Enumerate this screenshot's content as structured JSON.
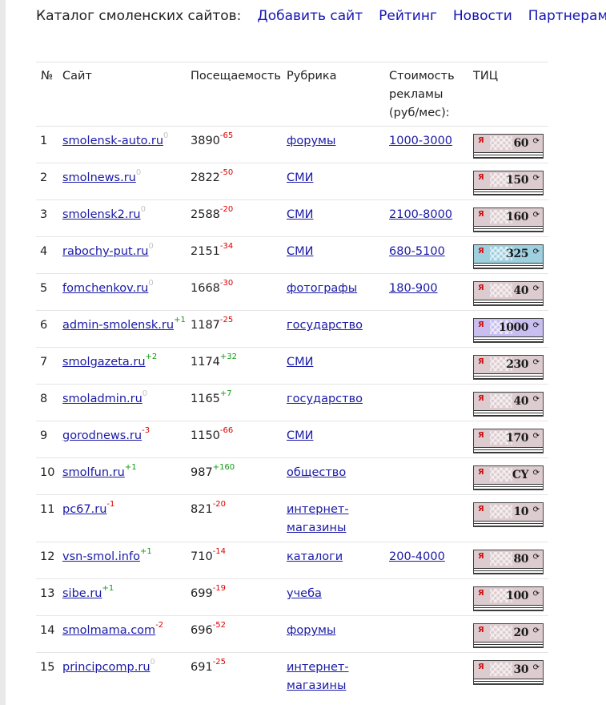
{
  "nav": {
    "title": "Каталог смоленских сайтов:",
    "links": [
      "Добавить сайт",
      "Рейтинг",
      "Новости",
      "Партнерам"
    ]
  },
  "table": {
    "headers": {
      "num": "№",
      "site": "Сайт",
      "visits": "Посещаемость",
      "category": "Рубрика",
      "price": "Стоимость рекламы (руб/мес):",
      "tic": "ТИЦ"
    },
    "rows": [
      {
        "num": "1",
        "site": "smolensk-auto.ru",
        "site_delta": "0",
        "visits": "3890",
        "visits_delta": "-65",
        "category": "форумы",
        "price": "1000-3000",
        "tic": "60"
      },
      {
        "num": "2",
        "site": "smolnews.ru",
        "site_delta": "0",
        "visits": "2822",
        "visits_delta": "-50",
        "category": "СМИ",
        "price": "",
        "tic": "150"
      },
      {
        "num": "3",
        "site": "smolensk2.ru",
        "site_delta": "0",
        "visits": "2588",
        "visits_delta": "-20",
        "category": "СМИ",
        "price": "2100-8000",
        "tic": "160"
      },
      {
        "num": "4",
        "site": "rabochy-put.ru",
        "site_delta": "0",
        "visits": "2151",
        "visits_delta": "-34",
        "category": "СМИ",
        "price": "680-5100",
        "tic": "325"
      },
      {
        "num": "5",
        "site": "fomchenkov.ru",
        "site_delta": "0",
        "visits": "1668",
        "visits_delta": "-30",
        "category": "фотографы",
        "price": "180-900",
        "tic": "40"
      },
      {
        "num": "6",
        "site": "admin-smolensk.ru",
        "site_delta": "+1",
        "visits": "1187",
        "visits_delta": "-25",
        "category": "государство",
        "price": "",
        "tic": "1000"
      },
      {
        "num": "7",
        "site": "smolgazeta.ru",
        "site_delta": "+2",
        "visits": "1174",
        "visits_delta": "+32",
        "category": "СМИ",
        "price": "",
        "tic": "230"
      },
      {
        "num": "8",
        "site": "smoladmin.ru",
        "site_delta": "0",
        "visits": "1165",
        "visits_delta": "+7",
        "category": "государство",
        "price": "",
        "tic": "40"
      },
      {
        "num": "9",
        "site": "gorodnews.ru",
        "site_delta": "-3",
        "visits": "1150",
        "visits_delta": "-66",
        "category": "СМИ",
        "price": "",
        "tic": "170"
      },
      {
        "num": "10",
        "site": "smolfun.ru",
        "site_delta": "+1",
        "visits": "987",
        "visits_delta": "+160",
        "category": "общество",
        "price": "",
        "tic": "CY"
      },
      {
        "num": "11",
        "site": "pc67.ru",
        "site_delta": "-1",
        "visits": "821",
        "visits_delta": "-20",
        "category": "интернет-магазины",
        "price": "",
        "tic": "10"
      },
      {
        "num": "12",
        "site": "vsn-smol.info",
        "site_delta": "+1",
        "visits": "710",
        "visits_delta": "-14",
        "category": "каталоги",
        "price": "200-4000",
        "tic": "80"
      },
      {
        "num": "13",
        "site": "sibe.ru",
        "site_delta": "+1",
        "visits": "699",
        "visits_delta": "-19",
        "category": "учеба",
        "price": "",
        "tic": "100"
      },
      {
        "num": "14",
        "site": "smolmama.com",
        "site_delta": "-2",
        "visits": "696",
        "visits_delta": "-52",
        "category": "форумы",
        "price": "",
        "tic": "20"
      },
      {
        "num": "15",
        "site": "principcomp.ru",
        "site_delta": "0",
        "visits": "691",
        "visits_delta": "-25",
        "category": "интернет-магазины",
        "price": "",
        "tic": "30"
      }
    ]
  },
  "tic_badge": {
    "mark": "Я",
    "refresh": "⟳",
    "colors": {
      "default": "#dccbcf",
      "blue": "#9fd0e0",
      "violet": "#c8bff0"
    }
  },
  "colors": {
    "link": "#1a1aa6",
    "nav_link": "#1515b4",
    "negative": "#dd0000",
    "positive": "#119911",
    "neutral": "#c4c4c4"
  }
}
